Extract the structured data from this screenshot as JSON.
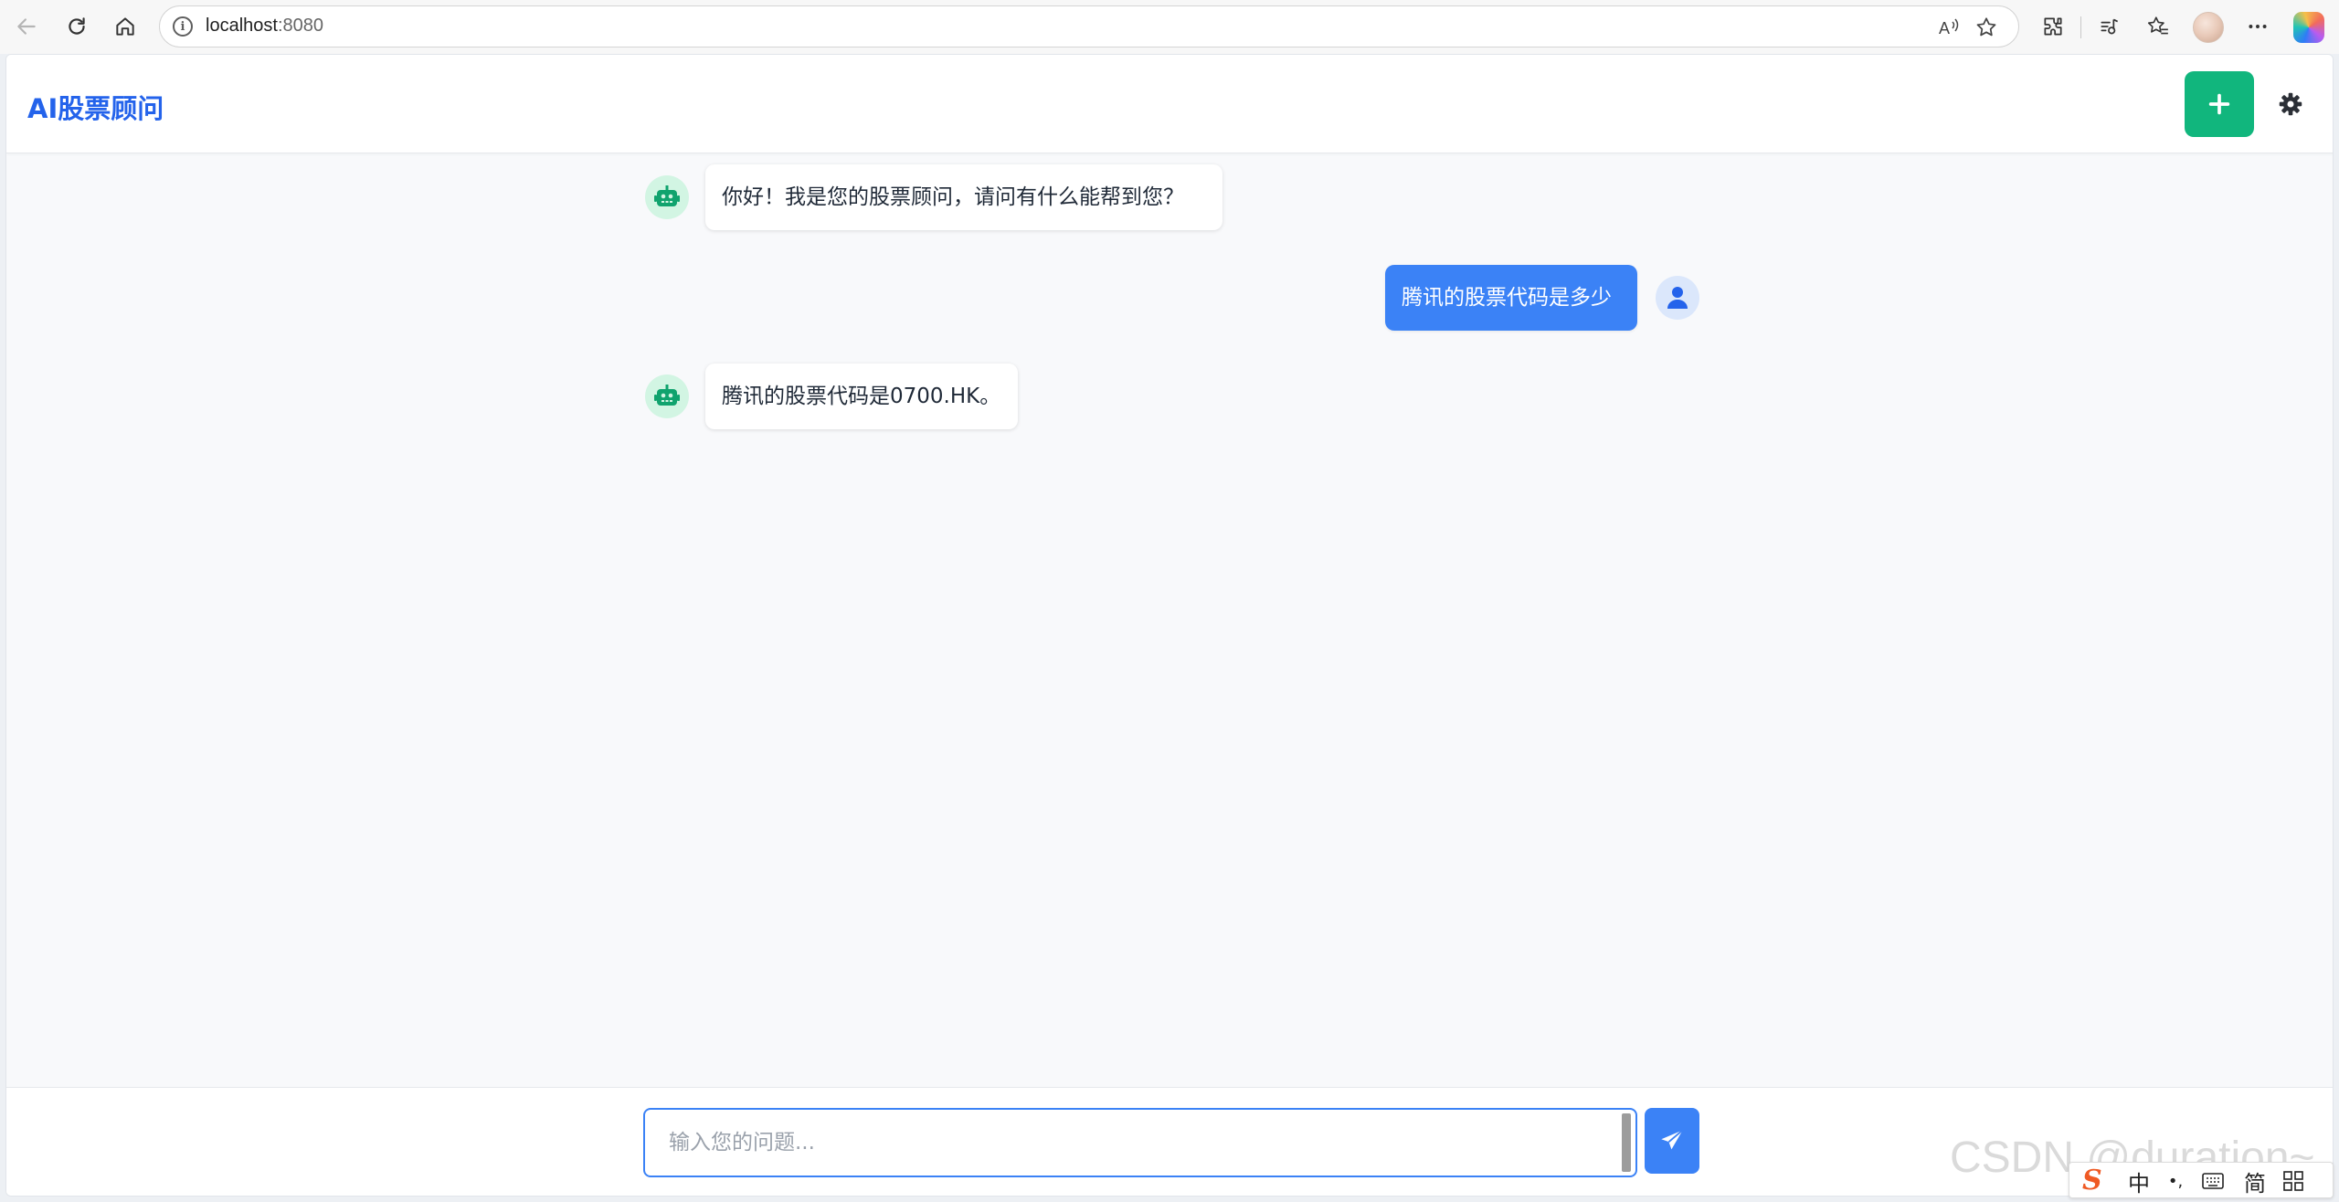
{
  "browser": {
    "url_host": "localhost",
    "url_port": ":8080"
  },
  "app": {
    "title": "AI股票顾问",
    "new_chat_label": "+",
    "accent": "#2463eb",
    "new_chat_color": "#11b67d",
    "user_bubble_color": "#3b82f6"
  },
  "messages": [
    {
      "role": "bot",
      "text": "你好！我是您的股票顾问，请问有什么能帮到您？"
    },
    {
      "role": "user",
      "text": "腾讯的股票代码是多少"
    },
    {
      "role": "bot",
      "text": "腾讯的股票代码是0700.HK。"
    }
  ],
  "composer": {
    "placeholder": "输入您的问题...",
    "value": ""
  },
  "watermark": "CSDN @duration~",
  "ime": {
    "logo": "S",
    "mode": "中",
    "punct": "•,",
    "script": "简"
  },
  "icons": [
    "back-arrow-icon",
    "reload-icon",
    "home-icon",
    "info-icon",
    "read-aloud-icon",
    "favorite-star-icon",
    "extensions-icon",
    "media-control-icon",
    "favorites-icon",
    "profile-avatar",
    "more-icon",
    "copilot-icon",
    "plus-icon",
    "gear-icon",
    "robot-icon",
    "user-icon",
    "paper-plane-icon"
  ]
}
